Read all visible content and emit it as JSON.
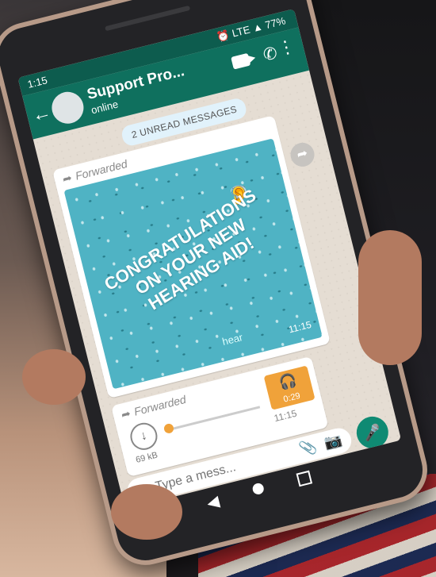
{
  "statusbar": {
    "time": "1:15",
    "network": "LTE",
    "battery": "77%"
  },
  "chat": {
    "contact_name": "Support Pro...",
    "contact_status": "online"
  },
  "unread_banner": "2 UNREAD MESSAGES",
  "messages": [
    {
      "forwarded_label": "Forwarded",
      "image_text": "CONGRATULATIONS ON YOUR NEW HEARING AID!",
      "brand": "hear",
      "time": "11:15"
    },
    {
      "forwarded_label": "Forwarded",
      "file_size": "69 kB",
      "time": "11:15",
      "audio_duration": "0:29",
      "playback_progress": 0
    }
  ],
  "composer": {
    "placeholder": "Type a mess..."
  },
  "icons": [
    "back-icon",
    "video-call-icon",
    "phone-icon",
    "menu-icon",
    "share-icon",
    "download-icon",
    "headphone-icon",
    "emoji-icon",
    "attach-icon",
    "camera-icon",
    "mic-icon"
  ],
  "colors": {
    "header": "#0f705e",
    "status_bar": "#0d5c4e",
    "audio_accent": "#f0a23a",
    "mic_button": "#0f8a73"
  }
}
